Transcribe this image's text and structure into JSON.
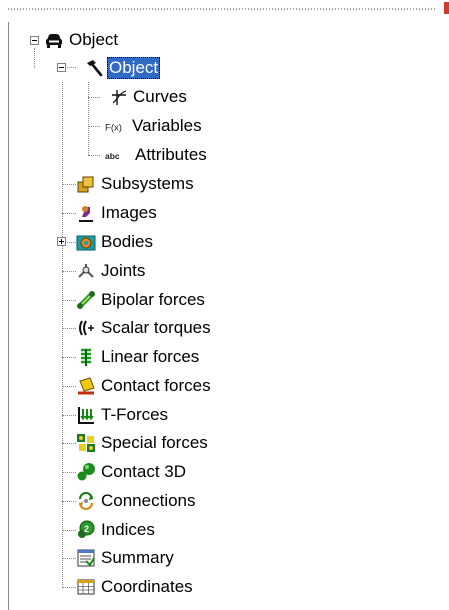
{
  "tree": {
    "root": {
      "label": "Object",
      "icon": "car-icon",
      "expanded": true
    },
    "object": {
      "label": "Object",
      "icon": "hammer-icon",
      "expanded": true,
      "selected": true
    },
    "object_children": [
      {
        "label": "Curves",
        "icon": "curve-axes-icon"
      },
      {
        "label": "Variables",
        "icon": "function-icon",
        "icon_text": "F(x)"
      },
      {
        "label": "Attributes",
        "icon": "abc-icon",
        "icon_text": "abc"
      }
    ],
    "items": [
      {
        "label": "Subsystems",
        "icon": "subsystems-icon"
      },
      {
        "label": "Images",
        "icon": "images-icon"
      },
      {
        "label": "Bodies",
        "icon": "bodies-icon",
        "expandable": true,
        "expanded": false
      },
      {
        "label": "Joints",
        "icon": "joints-icon"
      },
      {
        "label": "Bipolar forces",
        "icon": "bipolar-forces-icon"
      },
      {
        "label": "Scalar torques",
        "icon": "scalar-torques-icon"
      },
      {
        "label": "Linear forces",
        "icon": "linear-forces-icon"
      },
      {
        "label": "Contact forces",
        "icon": "contact-forces-icon"
      },
      {
        "label": "T-Forces",
        "icon": "t-forces-icon"
      },
      {
        "label": "Special forces",
        "icon": "special-forces-icon"
      },
      {
        "label": "Contact 3D",
        "icon": "contact-3d-icon"
      },
      {
        "label": "Connections",
        "icon": "connections-icon"
      },
      {
        "label": "Indices",
        "icon": "indices-icon"
      },
      {
        "label": "Summary",
        "icon": "summary-icon"
      },
      {
        "label": "Coordinates",
        "icon": "coordinates-icon"
      }
    ]
  },
  "colors": {
    "selection": "#316ac5",
    "tree_line": "#8a8a8a",
    "green": "#2e8b1f",
    "teal": "#11a0a0",
    "orange": "#e07a1a",
    "yellow": "#e8d020"
  }
}
